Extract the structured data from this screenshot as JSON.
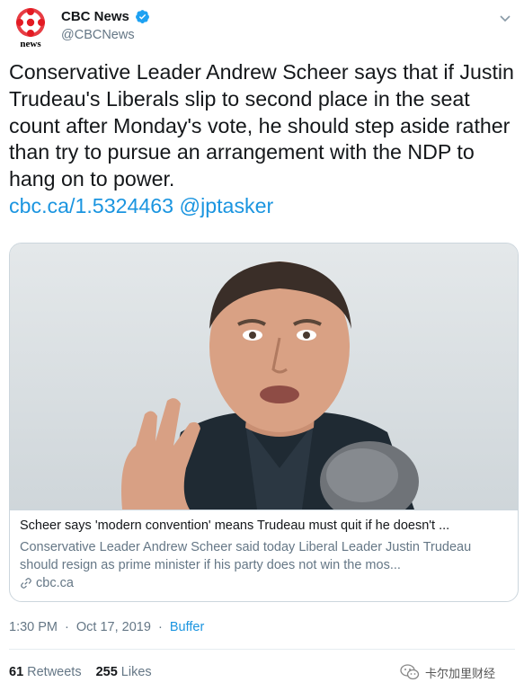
{
  "account": {
    "display_name": "CBC News",
    "handle": "@CBCNews",
    "logo_text": "news"
  },
  "tweet": {
    "text": "Conservative Leader Andrew Scheer says that if Justin Trudeau's Liberals slip to second place in the seat count after Monday's vote, he should step aside rather than try to pursue an arrangement with the NDP to hang on to power.",
    "link": "cbc.ca/1.5324463",
    "mention": "@jptasker"
  },
  "card": {
    "title": "Scheer says 'modern convention' means Trudeau must quit if he doesn't ...",
    "description": "Conservative Leader Andrew Scheer said today Liberal Leader Justin Trudeau should resign as prime minister if his party does not win the mos...",
    "domain": "cbc.ca"
  },
  "meta": {
    "time": "1:30 PM",
    "separator": "·",
    "date": "Oct 17, 2019",
    "source": "Buffer"
  },
  "stats": {
    "retweets_count": "61",
    "retweets_label": "Retweets",
    "likes_count": "255",
    "likes_label": "Likes"
  },
  "watermark": {
    "text": "卡尔加里财经"
  },
  "colors": {
    "link": "#1b95e0",
    "cbc_red": "#e31b23",
    "muted": "#657786"
  },
  "icons": [
    "cbc-gem-logo",
    "verified-badge-icon",
    "chevron-down-icon",
    "link-icon",
    "wechat-icon"
  ]
}
